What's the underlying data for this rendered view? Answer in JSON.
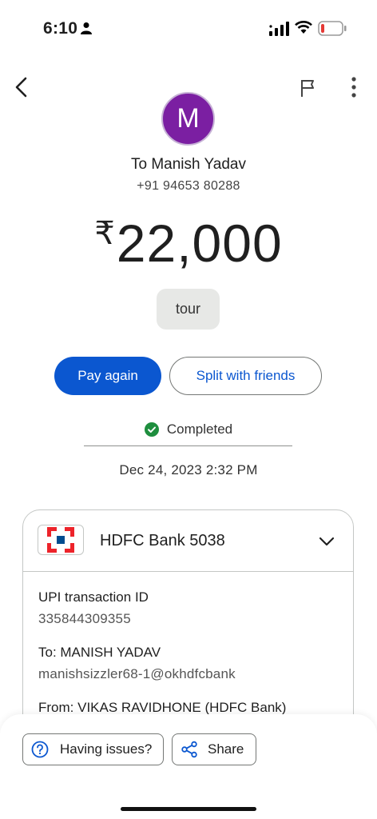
{
  "status_bar": {
    "time": "6:10",
    "icons": [
      "person-icon",
      "signal-icon",
      "wifi-icon",
      "battery-icon"
    ],
    "battery_color": "#e53935"
  },
  "app_bar": {
    "icons": [
      "back-arrow-icon",
      "flag-icon",
      "more-vert-icon"
    ]
  },
  "recipient": {
    "avatar_letter": "M",
    "avatar_color": "#7b1fa2",
    "name": "To Manish Yadav",
    "phone": "+91 94653 80288"
  },
  "amount": {
    "currency": "₹",
    "value": "22,000"
  },
  "note": "tour",
  "actions": {
    "pay_again": "Pay again",
    "split": "Split with friends"
  },
  "status": {
    "text": "Completed",
    "color": "#1e8e3e"
  },
  "datetime": "Dec 24, 2023 2:32 PM",
  "bank": {
    "name": "HDFC Bank 5038",
    "logo_colors": [
      "#ed232a",
      "#004c8f"
    ]
  },
  "details": {
    "upi_label": "UPI transaction ID",
    "upi_value": "335844309355",
    "to_label": "To: MANISH YADAV",
    "to_value": "manishsizzler68-1@okhdfcbank",
    "from_label": "From: VIKAS RAVIDHONE (HDFC Bank)"
  },
  "bottom": {
    "issues": "Having issues?",
    "share": "Share"
  },
  "accent_color": "#0b57d0"
}
